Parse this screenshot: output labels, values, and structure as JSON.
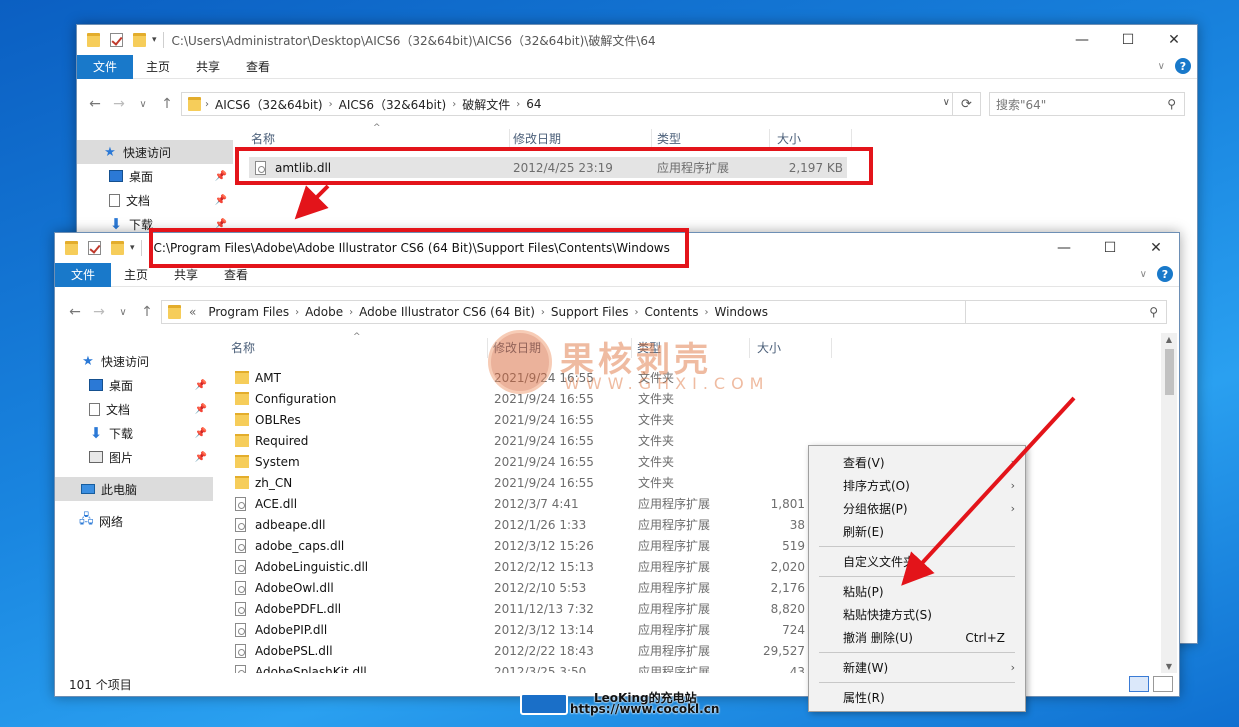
{
  "top_window": {
    "title": "C:\\Users\\Administrator\\Desktop\\AICS6（32&64bit)\\AICS6（32&64bit)\\破解文件\\64",
    "ribbon_tabs": [
      "文件",
      "主页",
      "共享",
      "查看"
    ],
    "breadcrumbs": [
      "AICS6（32&64bit)",
      "AICS6（32&64bit)",
      "破解文件",
      "64"
    ],
    "search_placeholder": "搜索\"64\"",
    "columns": [
      "名称",
      "修改日期",
      "类型",
      "大小"
    ],
    "file": {
      "name": "amtlib.dll",
      "date": "2012/4/25 23:19",
      "type": "应用程序扩展",
      "size": "2,197 KB"
    },
    "sidebar": [
      "快速访问",
      "桌面",
      "文档",
      "下载"
    ]
  },
  "bottom_window": {
    "title": "C:\\Program Files\\Adobe\\Adobe Illustrator CS6 (64 Bit)\\Support Files\\Contents\\Windows",
    "ribbon_tabs": [
      "文件",
      "主页",
      "共享",
      "查看"
    ],
    "breadcrumb_prefix": "«",
    "breadcrumbs": [
      "Program Files",
      "Adobe",
      "Adobe Illustrator CS6 (64 Bit)",
      "Support Files",
      "Contents",
      "Windows"
    ],
    "columns": [
      "名称",
      "修改日期",
      "类型",
      "大小"
    ],
    "sidebar": [
      "快速访问",
      "桌面",
      "文档",
      "下载",
      "图片",
      "此电脑",
      "网络"
    ],
    "rows": [
      {
        "name": "AMT",
        "date": "2021/9/24 16:55",
        "type": "文件夹",
        "size": "",
        "kind": "folder"
      },
      {
        "name": "Configuration",
        "date": "2021/9/24 16:55",
        "type": "文件夹",
        "size": "",
        "kind": "folder"
      },
      {
        "name": "OBLRes",
        "date": "2021/9/24 16:55",
        "type": "文件夹",
        "size": "",
        "kind": "folder"
      },
      {
        "name": "Required",
        "date": "2021/9/24 16:55",
        "type": "文件夹",
        "size": "",
        "kind": "folder"
      },
      {
        "name": "System",
        "date": "2021/9/24 16:55",
        "type": "文件夹",
        "size": "",
        "kind": "folder"
      },
      {
        "name": "zh_CN",
        "date": "2021/9/24 16:55",
        "type": "文件夹",
        "size": "",
        "kind": "folder"
      },
      {
        "name": "ACE.dll",
        "date": "2012/3/7 4:41",
        "type": "应用程序扩展",
        "size": "1,801",
        "kind": "dll"
      },
      {
        "name": "adbeape.dll",
        "date": "2012/1/26 1:33",
        "type": "应用程序扩展",
        "size": "38",
        "kind": "dll"
      },
      {
        "name": "adobe_caps.dll",
        "date": "2012/3/12 15:26",
        "type": "应用程序扩展",
        "size": "519",
        "kind": "dll"
      },
      {
        "name": "AdobeLinguistic.dll",
        "date": "2012/2/12 15:13",
        "type": "应用程序扩展",
        "size": "2,020",
        "kind": "dll"
      },
      {
        "name": "AdobeOwl.dll",
        "date": "2012/2/10 5:53",
        "type": "应用程序扩展",
        "size": "2,176",
        "kind": "dll"
      },
      {
        "name": "AdobePDFL.dll",
        "date": "2011/12/13 7:32",
        "type": "应用程序扩展",
        "size": "8,820",
        "kind": "dll"
      },
      {
        "name": "AdobePIP.dll",
        "date": "2012/3/12 13:14",
        "type": "应用程序扩展",
        "size": "724",
        "kind": "dll"
      },
      {
        "name": "AdobePSL.dll",
        "date": "2012/2/22 18:43",
        "type": "应用程序扩展",
        "size": "29,527",
        "kind": "dll"
      },
      {
        "name": "AdobeSplashKit.dll",
        "date": "2012/3/25 3:50",
        "type": "应用程序扩展",
        "size": "43",
        "kind": "dll"
      }
    ],
    "status": "101 个项目"
  },
  "context_menu": {
    "items": [
      {
        "label": "查看(V)",
        "submenu": true
      },
      {
        "label": "排序方式(O)",
        "submenu": true
      },
      {
        "label": "分组依据(P)",
        "submenu": true
      },
      {
        "label": "刷新(E)"
      },
      {
        "label": "自定义文件夹..."
      },
      {
        "label": "粘贴(P)"
      },
      {
        "label": "粘贴快捷方式(S)"
      },
      {
        "label": "撤消 删除(U)",
        "shortcut": "Ctrl+Z"
      },
      {
        "label": "新建(W)",
        "submenu": true
      },
      {
        "label": "属性(R)"
      }
    ]
  },
  "watermark": {
    "cn": "果核剥壳",
    "en": "WWW.GHXI.COM"
  },
  "footer": {
    "line1": "LeoKing的充电站",
    "line2": "https://www.cocokl.cn"
  },
  "icons": {
    "pin": "pin-icon",
    "search": "search-icon",
    "refresh": "refresh-icon"
  },
  "colors": {
    "highlight_red": "#e3141a",
    "ribbon_blue": "#1979ca"
  }
}
